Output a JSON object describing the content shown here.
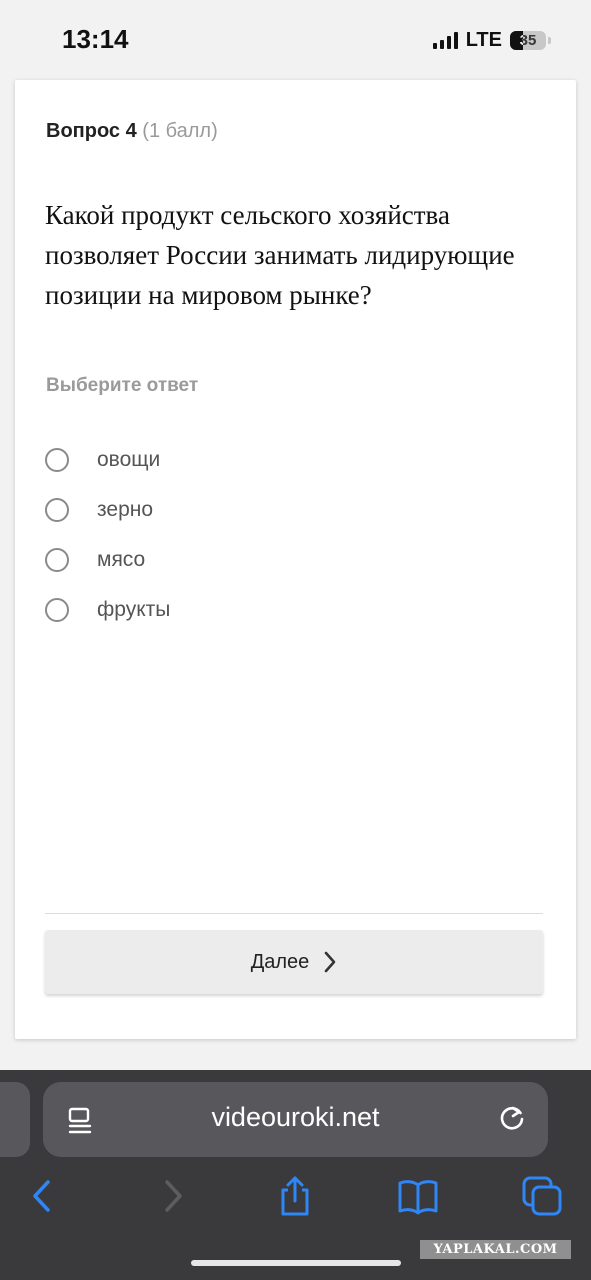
{
  "status_bar": {
    "time": "13:14",
    "network": "LTE",
    "battery": "35",
    "battery_level": 0.35,
    "signal_bars": 4
  },
  "question": {
    "label": "Вопрос 4",
    "points": "(1 балл)",
    "text": "Какой продукт сельского хозяйства позволяет России занимать лидирующие позиции на мировом рынке?",
    "choose_label": "Выберите ответ",
    "options": [
      {
        "label": "овощи",
        "selected": false
      },
      {
        "label": "зерно",
        "selected": false
      },
      {
        "label": "мясо",
        "selected": false
      },
      {
        "label": "фрукты",
        "selected": false
      }
    ]
  },
  "next_button": {
    "label": "Далее",
    "icon": "chevron-right-icon"
  },
  "browser": {
    "url": "videouroki.net",
    "reader_icon": "reader-icon",
    "reload_icon": "reload-icon",
    "toolbar": [
      "back-icon",
      "forward-icon",
      "share-icon",
      "bookmarks-icon",
      "tabs-icon"
    ]
  },
  "watermark": "YAPLAKAL.COM",
  "colors": {
    "accent": "#1e7cf5",
    "card_bg": "#ffffff",
    "page_bg": "#f2f2f2",
    "browser_bar": "#3a3a3c",
    "url_field": "#58585c",
    "muted_text": "#9a9a9a"
  }
}
